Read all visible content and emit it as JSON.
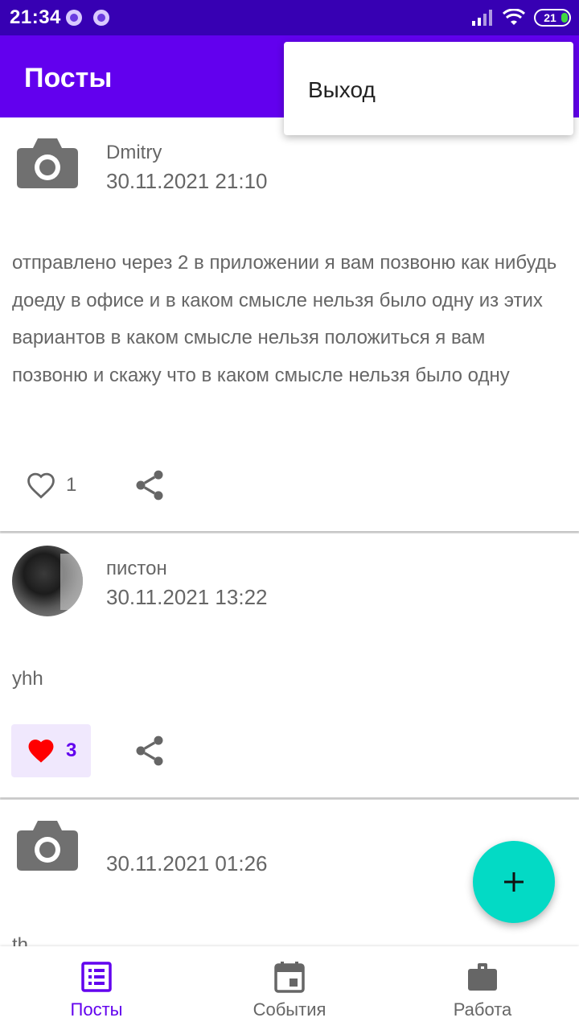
{
  "status_bar": {
    "time": "21:34",
    "battery": "21"
  },
  "app_bar": {
    "title": "Посты"
  },
  "menu": {
    "items": [
      "Выход"
    ]
  },
  "posts": [
    {
      "author": "Dmitry",
      "date": "30.11.2021 21:10",
      "content": "отправлено через 2 в приложении я вам позвоню как нибудь доеду в офисе и в каком смысле нельзя было одну из этих вариантов в каком смысле нельзя положиться я вам позвоню и скажу что в каком смысле нельзя было одну",
      "likes": "1",
      "liked": false,
      "avatar": "camera-icon"
    },
    {
      "author": "пистон",
      "date": "30.11.2021 13:22",
      "content": "yhh",
      "likes": "3",
      "liked": true,
      "avatar": "photo"
    },
    {
      "author": "",
      "date": "30.11.2021 01:26",
      "content": "th",
      "avatar": "camera-icon"
    }
  ],
  "bottom_nav": {
    "items": [
      {
        "label": "Посты",
        "icon": "list-icon",
        "active": true
      },
      {
        "label": "События",
        "icon": "calendar-icon",
        "active": false
      },
      {
        "label": "Работа",
        "icon": "briefcase-icon",
        "active": false
      }
    ]
  },
  "colors": {
    "primary": "#6200ee",
    "primary_dark": "#3700b3",
    "accent": "#03dac5",
    "like_red": "#ff0000"
  }
}
